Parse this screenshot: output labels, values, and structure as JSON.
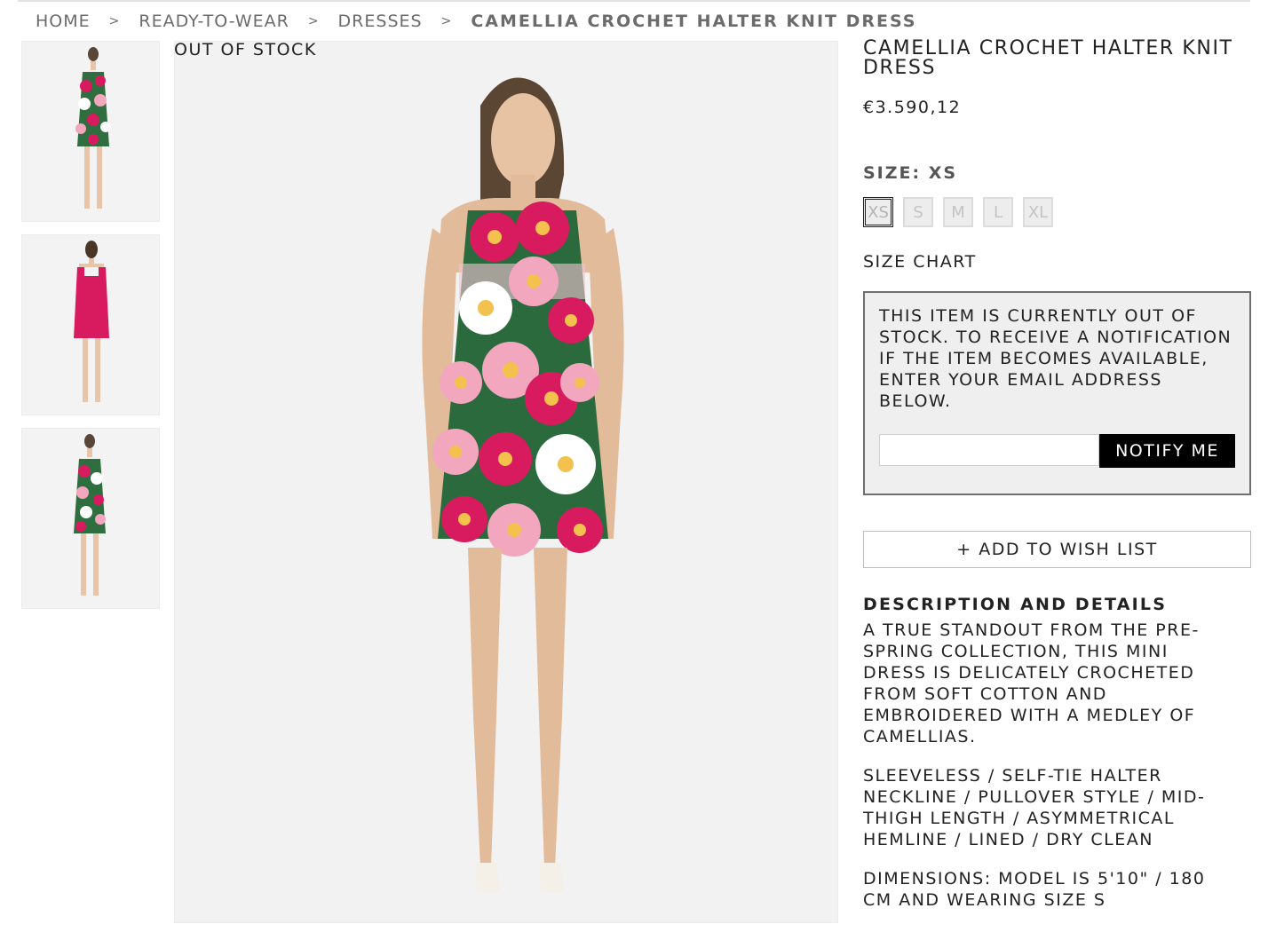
{
  "breadcrumb": {
    "items": [
      "HOME",
      "READY-TO-WEAR",
      "DRESSES"
    ],
    "separator": ">",
    "current": "CAMELLIA CROCHET HALTER KNIT DRESS"
  },
  "gallery": {
    "stock_label": "OUT OF STOCK",
    "thumbnails": [
      "front-view",
      "back-view",
      "side-view"
    ]
  },
  "product": {
    "title": "CAMELLIA CROCHET HALTER KNIT DRESS",
    "price": "€3.590,12",
    "size_label": "SIZE: XS",
    "sizes": [
      "XS",
      "S",
      "M",
      "L",
      "XL"
    ],
    "selected_size": "XS",
    "size_chart_label": "SIZE CHART"
  },
  "notify": {
    "message": "THIS ITEM IS CURRENTLY OUT OF STOCK. TO RECEIVE A NOTIFICATION IF THE ITEM BECOMES AVAILABLE, ENTER YOUR EMAIL ADDRESS BELOW.",
    "email_value": "",
    "button_label": "NOTIFY ME"
  },
  "wishlist": {
    "label": "+ ADD TO WISH LIST"
  },
  "description": {
    "heading": "DESCRIPTION AND DETAILS",
    "paragraph1": "A TRUE STANDOUT FROM THE PRE-SPRING COLLECTION, THIS MINI DRESS IS DELICATELY CROCHETED FROM SOFT COTTON AND EMBROIDERED WITH A MEDLEY OF CAMELLIAS.",
    "paragraph2": "SLEEVELESS / SELF-TIE HALTER NECKLINE / PULLOVER STYLE / MID-THIGH LENGTH / ASYMMETRICAL HEMLINE / LINED / DRY CLEAN",
    "paragraph3": "DIMENSIONS: MODEL IS 5'10\" / 180 CM AND WEARING SIZE S"
  },
  "colors": {
    "accent_pink": "#d81b5e",
    "light_pink": "#f2a7bf",
    "leaf_green": "#1e6b3a",
    "button_black": "#000000",
    "notify_bg": "#efefef"
  }
}
